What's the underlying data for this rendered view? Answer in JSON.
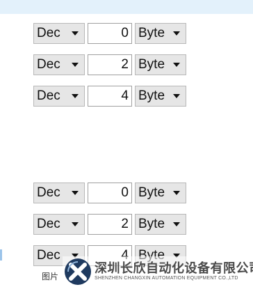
{
  "rows": [
    {
      "format": "Dec",
      "value": "0",
      "unit": "Byte"
    },
    {
      "format": "Dec",
      "value": "2",
      "unit": "Byte"
    },
    {
      "format": "Dec",
      "value": "4",
      "unit": "Byte"
    },
    {
      "format": "Dec",
      "value": "0",
      "unit": "Byte"
    },
    {
      "format": "Dec",
      "value": "2",
      "unit": "Byte"
    },
    {
      "format": "Dec",
      "value": "4",
      "unit": "Byte"
    }
  ],
  "caption": "图片",
  "watermark": {
    "name_cn": "深圳长欣自动化设备有限公司",
    "name_en": "SHENZHEN CHANGXIN AUTOMATION EQUIPMENT CO.,LTD",
    "logo_color_dark": "#1f3a5f",
    "logo_color_light": "#ffffff"
  }
}
